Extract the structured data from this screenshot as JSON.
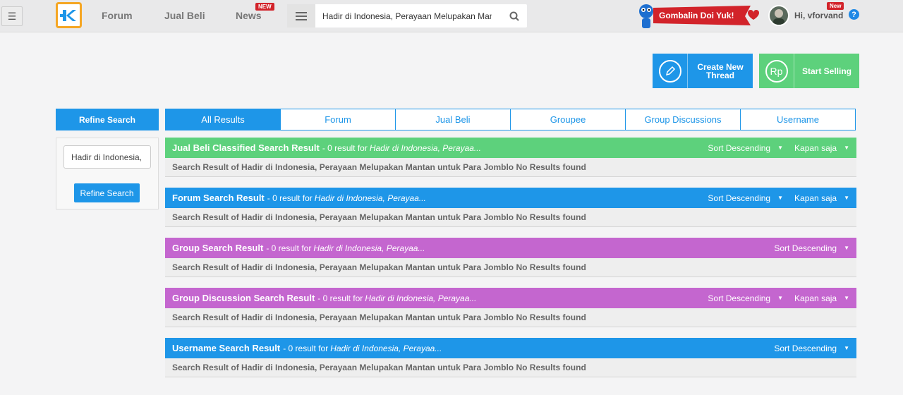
{
  "header": {
    "nav": {
      "forum": "Forum",
      "jual_beli": "Jual Beli",
      "news": "News",
      "news_badge": "NEW"
    },
    "search": {
      "value": "Hadir di Indonesia, Perayaan Melupakan Mantan untuk Para Jomblo"
    },
    "promo_text": "Gombalin Doi Yuk!",
    "user": {
      "greeting": "Hi, vforvand",
      "badge": "New"
    }
  },
  "actions": {
    "create_thread": "Create New Thread",
    "start_selling": "Start Selling",
    "rupiah_symbol": "Rp"
  },
  "sidebar": {
    "title": "Refine Search",
    "input_value": "Hadir di Indonesia, Perayaan Melupakan Mantan untuk Para Jomblo",
    "button": "Refine Search"
  },
  "tabs": [
    "All Results",
    "Forum",
    "Jual Beli",
    "Groupee",
    "Group Discussions",
    "Username"
  ],
  "sections": [
    {
      "title": "Jual Beli Classified Search Result",
      "count": "- 0 result for",
      "query": "Hadir di Indonesia, Perayaa...",
      "sort": "Sort Descending",
      "time": "Kapan saja",
      "body": "Search Result of Hadir di Indonesia, Perayaan Melupakan Mantan untuk Para Jomblo No Results found",
      "color": "#5dd17c"
    },
    {
      "title": "Forum Search Result",
      "count": "- 0 result for",
      "query": "Hadir di Indonesia, Perayaa...",
      "sort": "Sort Descending",
      "time": "Kapan saja",
      "body": "Search Result of Hadir di Indonesia, Perayaan Melupakan Mantan untuk Para Jomblo No Results found",
      "color": "#1e96e8"
    },
    {
      "title": "Group Search Result",
      "count": "- 0 result for",
      "query": "Hadir di Indonesia, Perayaa...",
      "sort": "Sort Descending",
      "body": "Search Result of Hadir di Indonesia, Perayaan Melupakan Mantan untuk Para Jomblo No Results found",
      "color": "#c466cf"
    },
    {
      "title": "Group Discussion Search Result",
      "count": "- 0 result for",
      "query": "Hadir di Indonesia, Perayaa...",
      "sort": "Sort Descending",
      "time": "Kapan saja",
      "body": "Search Result of Hadir di Indonesia, Perayaan Melupakan Mantan untuk Para Jomblo No Results found",
      "color": "#c466cf"
    },
    {
      "title": "Username Search Result",
      "count": "- 0 result for",
      "query": "Hadir di Indonesia, Perayaa...",
      "sort": "Sort Descending",
      "body": "Search Result of Hadir di Indonesia, Perayaan Melupakan Mantan untuk Para Jomblo No Results found",
      "color": "#1e96e8"
    }
  ]
}
